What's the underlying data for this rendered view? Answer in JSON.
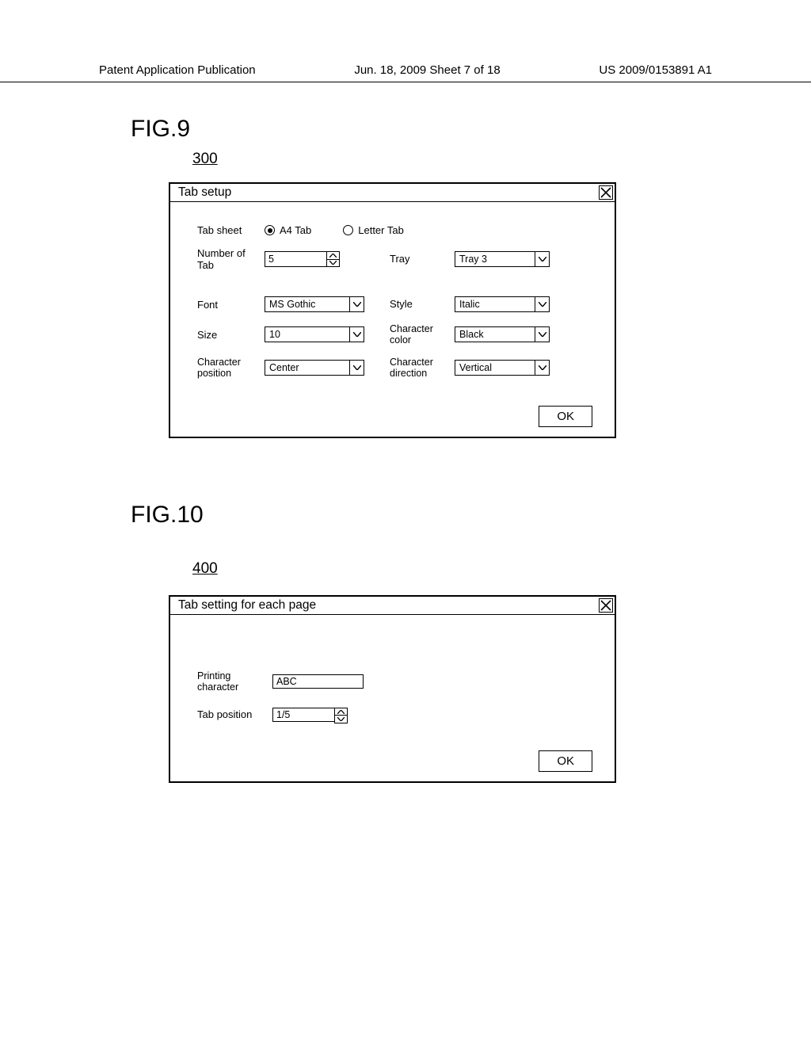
{
  "header": {
    "left": "Patent Application Publication",
    "center": "Jun. 18, 2009  Sheet 7 of 18",
    "right": "US 2009/0153891 A1"
  },
  "fig9": {
    "label": "FIG.9",
    "ref": "300",
    "title": "Tab setup",
    "tab_sheet_label": "Tab sheet",
    "a4_tab_label": "A4 Tab",
    "letter_tab_label": "Letter Tab",
    "number_of_tab_label": "Number of Tab",
    "number_of_tab_value": "5",
    "tray_label": "Tray",
    "tray_value": "Tray 3",
    "font_label": "Font",
    "font_value": "MS Gothic",
    "style_label": "Style",
    "style_value": "Italic",
    "size_label": "Size",
    "size_value": "10",
    "char_color_label": "Character\ncolor",
    "char_color_value": "Black",
    "char_position_label": "Character\nposition",
    "char_position_value": "Center",
    "char_direction_label": "Character\ndirection",
    "char_direction_value": "Vertical",
    "ok_label": "OK"
  },
  "fig10": {
    "label": "FIG.10",
    "ref": "400",
    "title": "Tab setting for each page",
    "printing_char_label": "Printing\ncharacter",
    "printing_char_value": "ABC",
    "tab_position_label": "Tab position",
    "tab_position_value": "1/5",
    "ok_label": "OK"
  }
}
